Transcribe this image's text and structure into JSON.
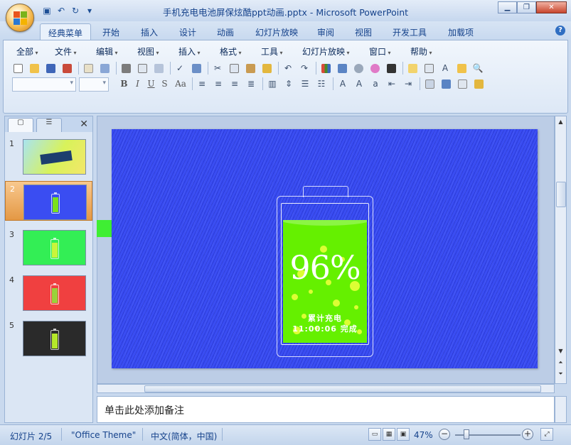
{
  "window": {
    "title": "手机充电电池屏保炫酷ppt动画.pptx - Microsoft PowerPoint",
    "min_icon": "minimize-icon",
    "max_icon": "restore-icon",
    "close_icon": "close-icon"
  },
  "qat": {
    "icons": [
      "save-icon",
      "undo-icon",
      "redo-icon",
      "customize-icon"
    ]
  },
  "tabs": [
    {
      "label": "经典菜单",
      "active": true
    },
    {
      "label": "开始"
    },
    {
      "label": "插入"
    },
    {
      "label": "设计"
    },
    {
      "label": "动画"
    },
    {
      "label": "幻灯片放映"
    },
    {
      "label": "审阅"
    },
    {
      "label": "视图"
    },
    {
      "label": "开发工具"
    },
    {
      "label": "加载项"
    }
  ],
  "menus": [
    "全部",
    "文件",
    "编辑",
    "视图",
    "插入",
    "格式",
    "工具",
    "幻灯片放映",
    "窗口",
    "帮助"
  ],
  "fmt": {
    "bold": "B",
    "italic": "I",
    "underline": "U",
    "shadow": "S",
    "case": "Aa"
  },
  "slides_pane": {
    "tab_slides_icon": "slides-tab-icon",
    "tab_outline_icon": "outline-tab-icon",
    "close": "✕",
    "thumbs": [
      {
        "num": "1",
        "color": "#c9e86a"
      },
      {
        "num": "2",
        "color": "#3a4df2",
        "selected": true
      },
      {
        "num": "3",
        "color": "#33ee55"
      },
      {
        "num": "4",
        "color": "#f04040"
      },
      {
        "num": "5",
        "color": "#2a2a2a"
      }
    ]
  },
  "slide": {
    "percent": "96%",
    "level": 0.96,
    "label_line1": "累计充电",
    "label_line2": "11:00:06 完成",
    "bg_color": "#3a4df2",
    "fill_color": "#65f000"
  },
  "notes": {
    "placeholder": "单击此处添加备注"
  },
  "status": {
    "slide_info": "幻灯片 2/5",
    "theme": "\"Office Theme\"",
    "language": "中文(简体，中国)",
    "zoom": "47%"
  }
}
